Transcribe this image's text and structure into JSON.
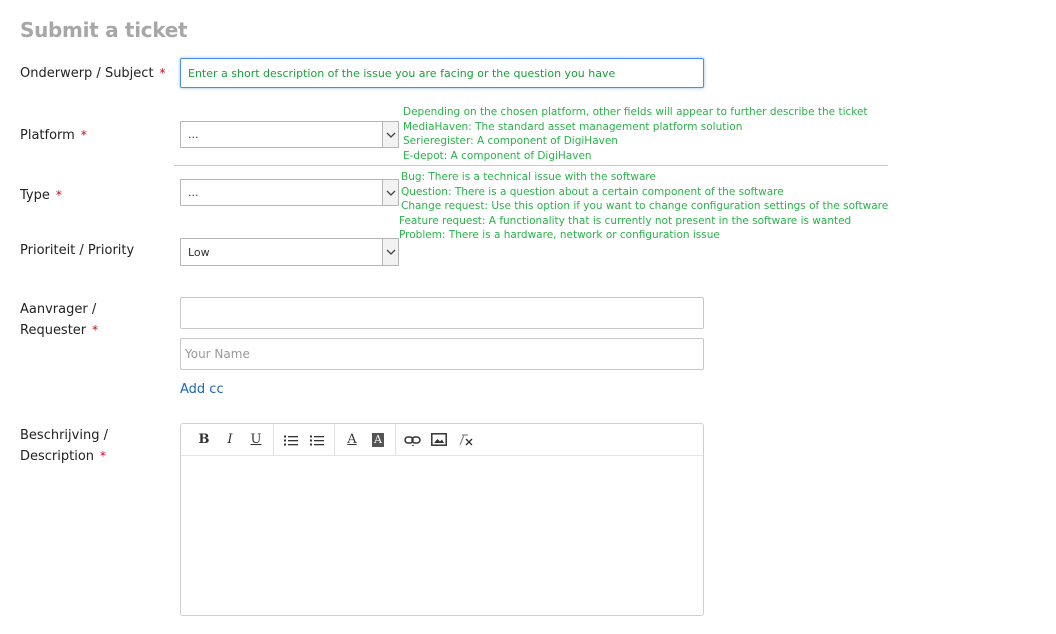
{
  "title": "Submit a ticket",
  "fields": {
    "subject": {
      "label": "Onderwerp / Subject",
      "required": "*",
      "placeholder": "Enter a short description of the issue you are facing or the question you have"
    },
    "platform": {
      "label": "Platform",
      "required": "*",
      "value": "...",
      "help": [
        "Depending on the chosen platform, other fields will appear to further describe the ticket",
        "MediaHaven: The standard asset management platform solution",
        "Serieregister: A component of DigiHaven",
        "E-depot: A component of DigiHaven"
      ]
    },
    "type": {
      "label": "Type",
      "required": "*",
      "value": "...",
      "help": [
        "Bug: There is a technical issue with the software",
        "Question: There is a question about a certain component of the software",
        "Change request: Use this option if you want to change configuration settings of the software",
        "Feature request: A functionality that is currently not present in the software is wanted",
        "Problem: There is a hardware, network or configuration issue"
      ]
    },
    "priority": {
      "label": "Prioriteit / Priority",
      "value": "Low"
    },
    "requester": {
      "label_line1": "Aanvrager /",
      "label_line2": "Requester",
      "required": "*",
      "email_value": "",
      "name_placeholder": "Your Name",
      "add_cc": "Add cc"
    },
    "description": {
      "label_line1": "Beschrijving /",
      "label_line2": "Description",
      "required": "*",
      "toolbar": {
        "bold": "B",
        "italic": "I",
        "underline": "U",
        "font_color": "A",
        "bg_color": "A"
      }
    }
  },
  "colors": {
    "help_text": "#2ab24a",
    "required_mark": "#d0021b",
    "link": "#1a66b8",
    "focus_border": "#4a90e2"
  }
}
